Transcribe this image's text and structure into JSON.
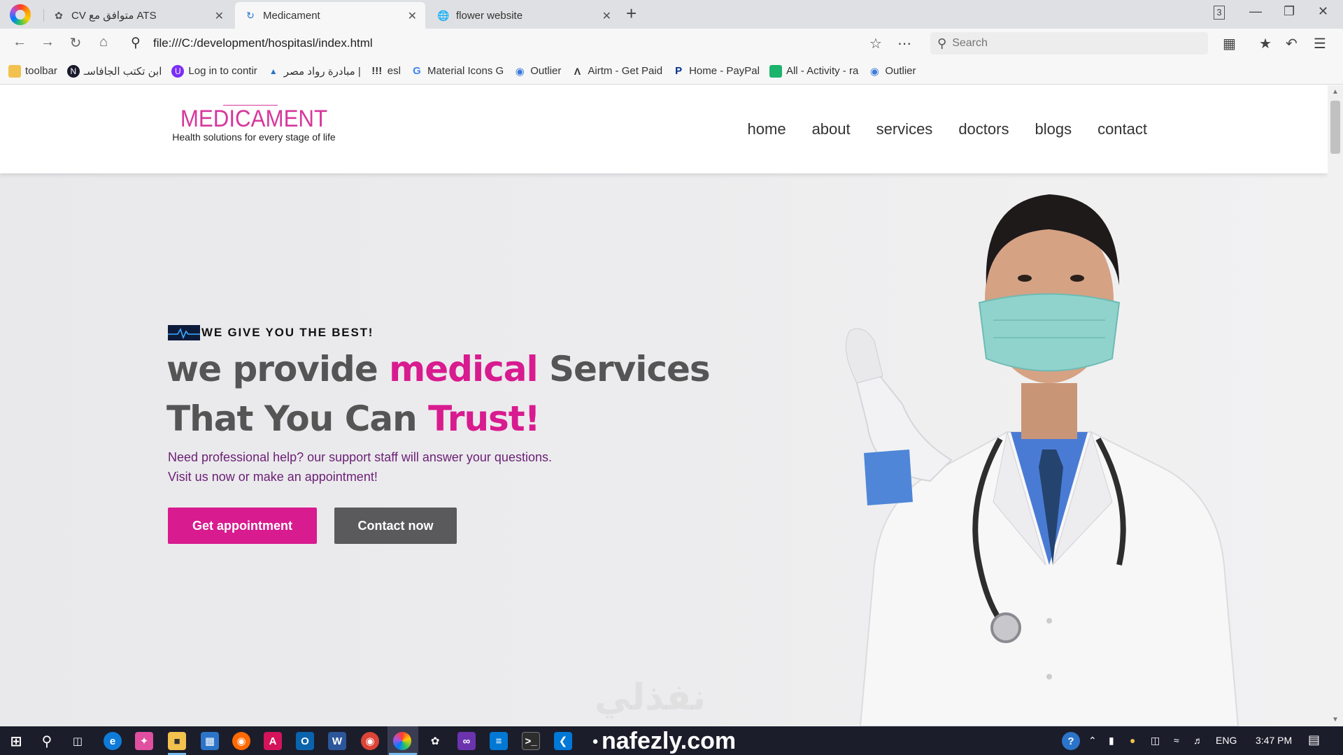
{
  "browser": {
    "tabs": [
      {
        "label": "CV متوافق مع ATS",
        "icon": "openai-icon"
      },
      {
        "label": "Medicament",
        "icon": "loading-icon"
      },
      {
        "label": "flower website",
        "icon": "globe-icon"
      }
    ],
    "url": "file:///C:/development/hospitasl/index.html",
    "search_placeholder": "Search",
    "tab_count_badge": "3",
    "bookmarks": [
      {
        "label": "toolbar",
        "icon": "folder-icon",
        "color": "#f2c14e"
      },
      {
        "label": "ابن تكتب الجافاسـ",
        "icon": "n-icon",
        "color": "#1a1a2e"
      },
      {
        "label": "Log in to contir",
        "icon": "u-icon",
        "color": "#7b2ff7"
      },
      {
        "label": "مبادرة رواد مصر |",
        "icon": "rowad-icon",
        "color": "#2b74c9"
      },
      {
        "label": "esl",
        "icon": "exclamation-icon",
        "color": "#111111"
      },
      {
        "label": "Material Icons G",
        "icon": "google-icon",
        "color": "#4285f4"
      },
      {
        "label": "Outlier",
        "icon": "outlier-icon",
        "color": "#3d7bd9"
      },
      {
        "label": "Airtm - Get Paid",
        "icon": "airtm-icon",
        "color": "#111111"
      },
      {
        "label": "Home - PayPal",
        "icon": "paypal-icon",
        "color": "#003087"
      },
      {
        "label": "All - Activity - ra",
        "icon": "activity-icon",
        "color": "#1cb36b"
      },
      {
        "label": "Outlier",
        "icon": "outlier-icon",
        "color": "#3d7bd9"
      }
    ]
  },
  "site": {
    "logo_title": "MEDICAMENT",
    "logo_tagline": "Health solutions for every stage of life",
    "nav": [
      "home",
      "about",
      "services",
      "doctors",
      "blogs",
      "contact"
    ],
    "hero": {
      "kicker": "WE GIVE YOU THE BEST!",
      "line1_a": "we provide ",
      "line1_b": "medical",
      "line1_c": " Services",
      "line2_a": "That You Can ",
      "line2_b": "Trust!",
      "sub1": "Need professional help? our support staff will answer your questions.",
      "sub2": "Visit us now or make an appointment!",
      "btn_primary": "Get appointment",
      "btn_secondary": "Contact now"
    },
    "watermark": "نفذلي"
  },
  "taskbar": {
    "watermark": "nafezly.com",
    "lang": "ENG",
    "time": "3:47 PM"
  },
  "colors": {
    "brand_pink": "#d81b8f",
    "dark_button": "#5a5a5c",
    "subtext_purple": "#6b1f75"
  }
}
